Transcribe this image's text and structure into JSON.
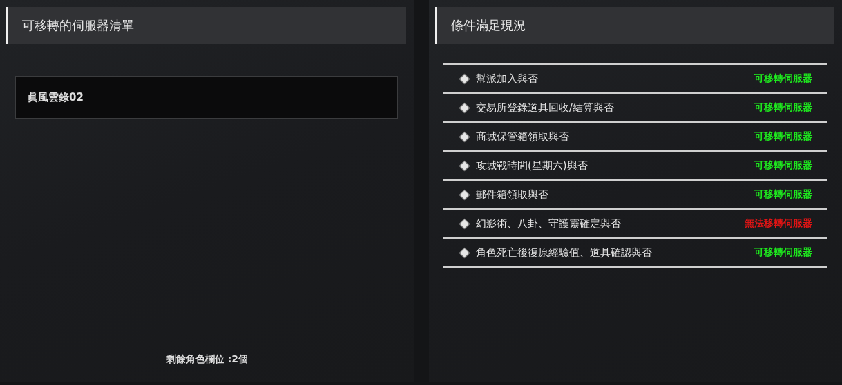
{
  "server_panel": {
    "title": "可移轉的伺服器清單",
    "servers": [
      {
        "name": "眞風雲錄02"
      }
    ],
    "footer": "剩餘角色欄位 :2個"
  },
  "conditions_panel": {
    "title": "條件滿足現況",
    "conditions": [
      {
        "label": "幫派加入與否",
        "status": "可移轉伺服器",
        "kind": "ok"
      },
      {
        "label": "交易所登錄道具回收/結算與否",
        "status": "可移轉伺服器",
        "kind": "ok"
      },
      {
        "label": "商城保管箱領取與否",
        "status": "可移轉伺服器",
        "kind": "ok"
      },
      {
        "label": "攻城戰時間(星期六)與否",
        "status": "可移轉伺服器",
        "kind": "ok"
      },
      {
        "label": "郵件箱領取與否",
        "status": "可移轉伺服器",
        "kind": "ok"
      },
      {
        "label": "幻影術、八卦、守護靈確定與否",
        "status": "無法移轉伺服器",
        "kind": "blocked"
      },
      {
        "label": "角色死亡後復原經驗值、道具確認與否",
        "status": "可移轉伺服器",
        "kind": "ok"
      }
    ]
  }
}
